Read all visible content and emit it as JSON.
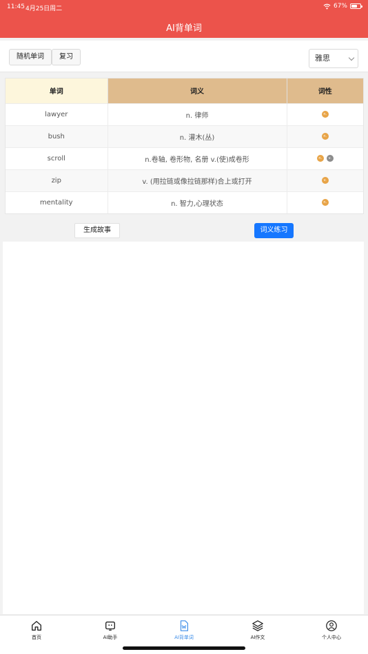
{
  "status": {
    "time": "11:45",
    "date": "4月25日周二",
    "battery": "67%",
    "battery_level": 0.67
  },
  "header": {
    "title": "AI背单词"
  },
  "toolbar": {
    "random_label": "随机单词",
    "review_label": "复习",
    "select_value": "雅思"
  },
  "table": {
    "headers": {
      "word": "单词",
      "meaning": "词义",
      "pos": "词性"
    },
    "rows": [
      {
        "word": "lawyer",
        "meaning": "n. 律师",
        "pos": [
          "n."
        ]
      },
      {
        "word": "bush",
        "meaning": "n. 灌木(丛)",
        "pos": [
          "n."
        ]
      },
      {
        "word": "scroll",
        "meaning": "n.卷轴, 卷形物, 名册 v.(使)成卷形",
        "pos": [
          "n.",
          "v."
        ]
      },
      {
        "word": "zip",
        "meaning": "v. (用拉链或像拉链那样)合上或打开",
        "pos": [
          "v."
        ]
      },
      {
        "word": "mentality",
        "meaning": "n. 智力,心理状态",
        "pos": [
          "n."
        ]
      }
    ]
  },
  "actions": {
    "story_label": "生成故事",
    "practice_label": "词义练习"
  },
  "tabbar": {
    "items": [
      {
        "label": "首页",
        "icon": "home-icon"
      },
      {
        "label": "AI助手",
        "icon": "robot-icon"
      },
      {
        "label": "AI背单词",
        "icon": "word-doc-icon"
      },
      {
        "label": "AI作文",
        "icon": "layers-icon"
      },
      {
        "label": "个人中心",
        "icon": "user-circle-icon"
      }
    ],
    "active_index": 2
  },
  "colors": {
    "header": "#ec534b",
    "primary": "#1677ff",
    "tab_active": "#3b8ce8",
    "pos_n": "#e8a447",
    "pos_v": "#8c8c8c"
  }
}
